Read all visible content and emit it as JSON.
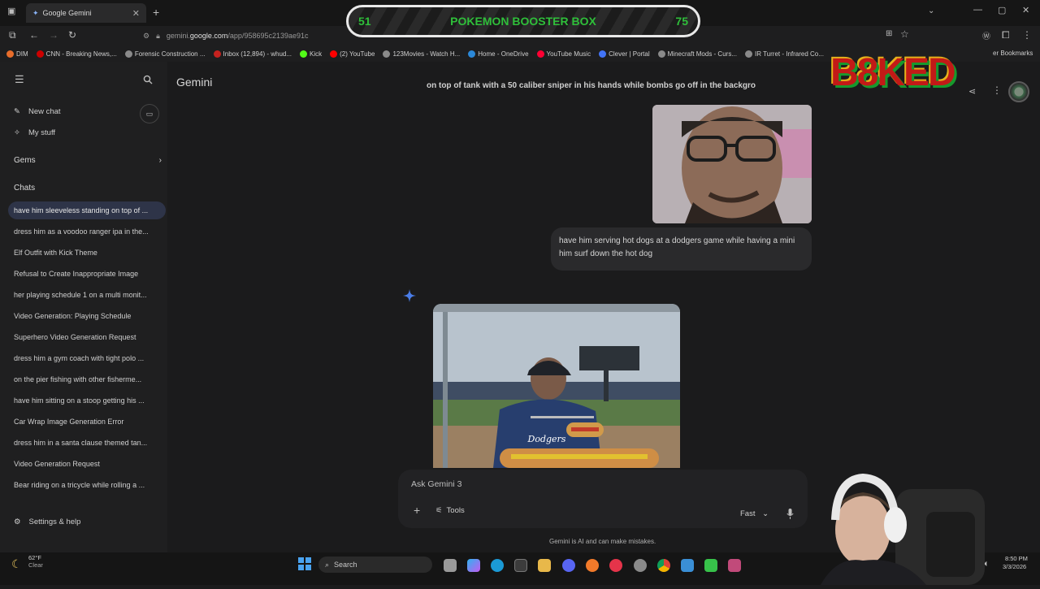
{
  "browser": {
    "tab_title": "Google Gemini",
    "url_prefix": "gemini.",
    "url_host": "google.com",
    "url_path": "/app/958695c2139ae91c",
    "bookmarks": [
      {
        "label": "DIM",
        "color": "#e86d2b"
      },
      {
        "label": "CNN - Breaking News,...",
        "color": "#cc0000"
      },
      {
        "label": "Forensic Construction ...",
        "color": "#8a8a8a"
      },
      {
        "label": "Inbox (12,894) - whud...",
        "color": "#c5221f"
      },
      {
        "label": "Kick",
        "color": "#53fc18"
      },
      {
        "label": "(2) YouTube",
        "color": "#ff0000"
      },
      {
        "label": "123Movies - Watch H...",
        "color": "#8a8a8a"
      },
      {
        "label": "Home - OneDrive",
        "color": "#2b88d8"
      },
      {
        "label": "YouTube Music",
        "color": "#ff0033"
      },
      {
        "label": "Clever | Portal",
        "color": "#4274f6"
      },
      {
        "label": "Minecraft Mods - Curs...",
        "color": "#8a8a8a"
      },
      {
        "label": "IR Turret - Infrared Co...",
        "color": "#8a8a8a"
      }
    ],
    "other_bookmarks": "er Bookmarks"
  },
  "overlay": {
    "left_number": "51",
    "banner_title": "POKEMON BOOSTER BOX",
    "right_number": "75",
    "logo_text": "B8KED"
  },
  "sidebar": {
    "new_chat": "New chat",
    "my_stuff": "My stuff",
    "gems": "Gems",
    "chats_heading": "Chats",
    "chats": [
      "have him sleeveless standing on top of ...",
      "dress him as a voodoo ranger ipa in the...",
      "Elf Outfit with Kick Theme",
      "Refusal to Create Inappropriate Image",
      "her playing schedule 1 on a multi monit...",
      "Video Generation: Playing Schedule",
      "Superhero Video Generation Request",
      "dress him a gym coach with tight polo ...",
      "on the pier fishing with other fisherme...",
      "have him sitting on a stoop getting his ...",
      "Car Wrap Image Generation Error",
      "dress him in a santa clause themed tan...",
      "Video Generation Request",
      "Bear riding on a tricycle while rolling a ..."
    ],
    "settings": "Settings & help"
  },
  "main": {
    "title": "Gemini",
    "previous_prompt": "on top of tank with a 50 caliber sniper in his hands while bombs go off in the backgro",
    "user_message": "have him serving hot dogs at a dodgers game while having a mini him surf down the hot dog",
    "input_placeholder": "Ask Gemini 3",
    "tools_label": "Tools",
    "mode_label": "Fast",
    "disclaimer": "Gemini is AI and can make mistakes."
  },
  "taskbar": {
    "weather_temp": "62°F",
    "weather_desc": "Clear",
    "search_label": "Search",
    "time": "8:50 PM",
    "date": "3/3/2026"
  },
  "image_text": {
    "jersey_text": "Dodgers"
  }
}
